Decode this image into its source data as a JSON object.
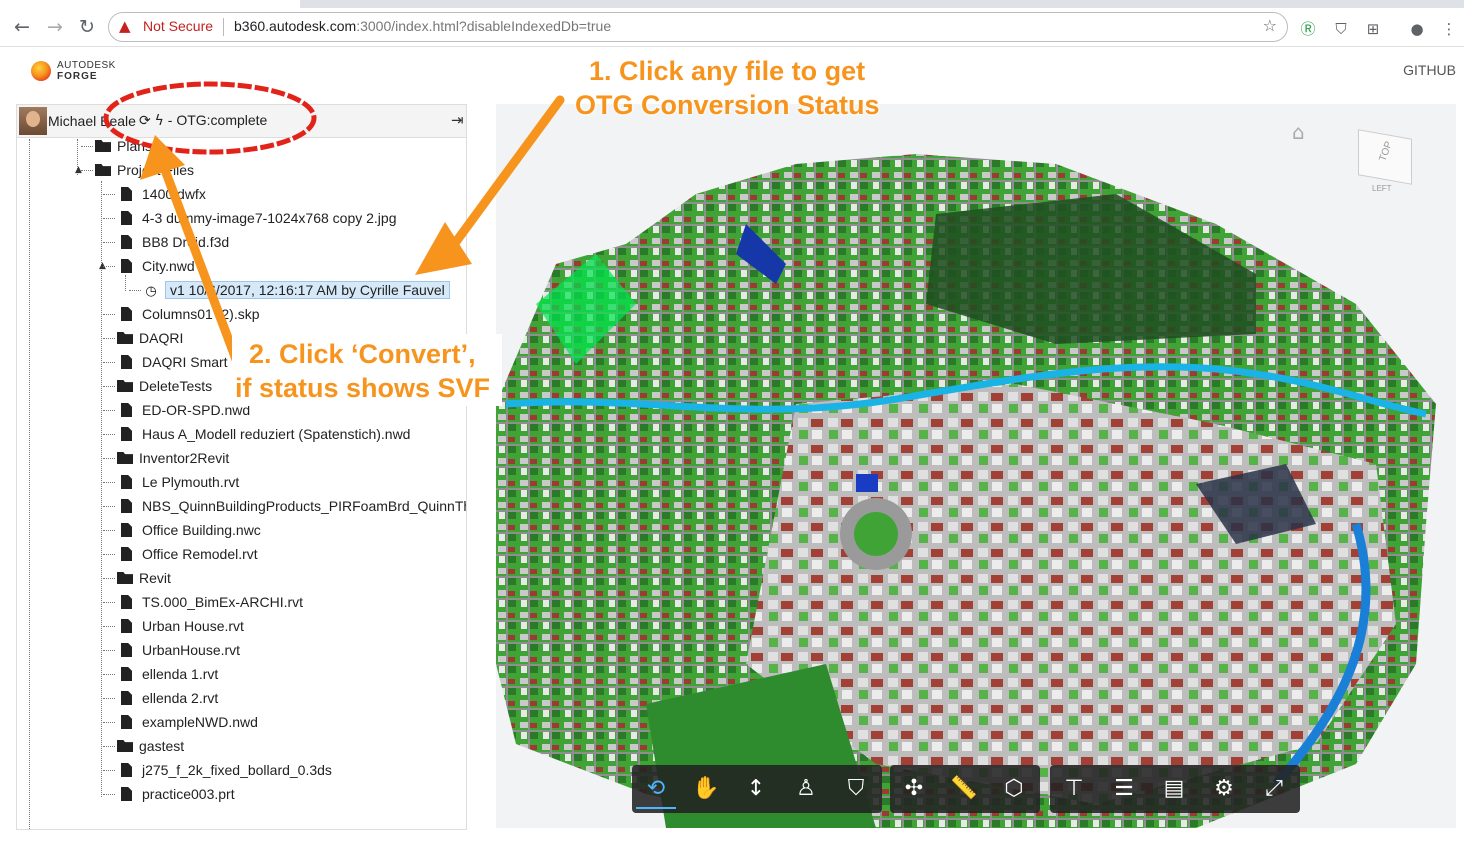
{
  "browser": {
    "nav": {
      "back": "←",
      "forward": "→",
      "reload": "↻"
    },
    "security_icon": "warning-triangle-icon",
    "not_secure_label": "Not Secure",
    "url_host": "b360.autodesk.com",
    "url_rest": ":3000/index.html?disableIndexedDb=true",
    "star_icon": "star-icon",
    "menu_icon": "⋮"
  },
  "app": {
    "logo_line1": "AUTODESK",
    "logo_line2": "FORGE",
    "github_label": "GITHUB"
  },
  "tree": {
    "user_name": "Michael Beale",
    "status_text": " - OTG:complete",
    "items": [
      {
        "label": "Plans",
        "type": "folder"
      },
      {
        "label": "Project Files",
        "type": "folder"
      },
      {
        "label": "1400.dwfx",
        "type": "file"
      },
      {
        "label": "4-3 dummy-image7-1024x768 copy 2.jpg",
        "type": "file"
      },
      {
        "label": "BB8 Droid.f3d",
        "type": "file"
      },
      {
        "label": "City.nwd",
        "type": "file"
      },
      {
        "label": "v1 10/6/2017, 12:16:17 AM by Cyrille Fauvel",
        "type": "version"
      },
      {
        "label": "Columns01 (2).skp",
        "type": "file"
      },
      {
        "label": "DAQRI",
        "type": "folder"
      },
      {
        "label": "DAQRI Smart",
        "type": "file"
      },
      {
        "label": "DeleteTests",
        "type": "folder"
      },
      {
        "label": "ED-OR-SPD.nwd",
        "type": "file"
      },
      {
        "label": "Haus A_Modell reduziert (Spatenstich).nwd",
        "type": "file"
      },
      {
        "label": "Inventor2Revit",
        "type": "folder"
      },
      {
        "label": "Le Plymouth.rvt",
        "type": "file"
      },
      {
        "label": "NBS_QuinnBuildingProducts_PIRFoamBrd_QuinnTh",
        "type": "file"
      },
      {
        "label": "Office Building.nwc",
        "type": "file"
      },
      {
        "label": "Office Remodel.rvt",
        "type": "file"
      },
      {
        "label": "Revit",
        "type": "folder"
      },
      {
        "label": "TS.000_BimEx-ARCHI.rvt",
        "type": "file"
      },
      {
        "label": "Urban House.rvt",
        "type": "file"
      },
      {
        "label": "UrbanHouse.rvt",
        "type": "file"
      },
      {
        "label": "ellenda 1.rvt",
        "type": "file"
      },
      {
        "label": "ellenda 2.rvt",
        "type": "file"
      },
      {
        "label": "exampleNWD.nwd",
        "type": "file"
      },
      {
        "label": "gastest",
        "type": "folder"
      },
      {
        "label": "j275_f_2k_fixed_bollard_0.3ds",
        "type": "file"
      },
      {
        "label": "practice003.prt",
        "type": "file"
      }
    ]
  },
  "annotations": {
    "step1_line1": "1. Click any file to get",
    "step1_line2": "OTG Conversion Status",
    "step2_line1": "2. Click ‘Convert’,",
    "step2_line2": "if status shows SVF",
    "accent_color": "#f7941d",
    "circle_color": "#e2231a"
  },
  "viewer": {
    "cube_top": "TOP",
    "cube_left": "LEFT",
    "toolbar_icons": [
      "orbit-icon",
      "pan-icon",
      "zoom-icon",
      "first-person-icon",
      "camera-icon",
      "explode-icon",
      "measure-icon",
      "section-icon",
      "model-browser-icon",
      "layers-icon",
      "properties-icon",
      "settings-icon",
      "fullscreen-icon"
    ]
  }
}
